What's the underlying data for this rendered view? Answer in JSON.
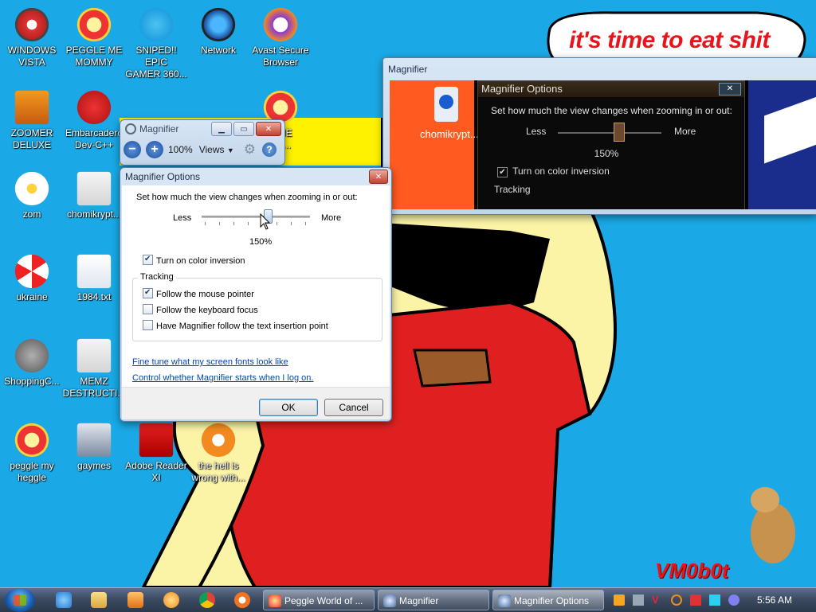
{
  "wallpaper": {
    "banner_text": "it's time to eat shit",
    "signature": "VM0b0t"
  },
  "desktop_icons": [
    {
      "label": "WINDOWS\nVISTA",
      "icon": "windows-vista-icon"
    },
    {
      "label": "PEGGLE ME\nMOMMY",
      "icon": "peggle-icon"
    },
    {
      "label": "SNIPED!! EPIC\nGAMER 360...",
      "icon": "skype-icon"
    },
    {
      "label": "Network",
      "icon": "network-icon"
    },
    {
      "label": "Avast Secure\nBrowser",
      "icon": "avast-browser-icon"
    },
    {
      "label": "ZOOMER\nDELUXE",
      "icon": "zoomer-icon"
    },
    {
      "label": "Embarcadero\nDev-C++",
      "icon": "devcpp-icon"
    },
    {
      "label": "zom",
      "icon": "flower-icon"
    },
    {
      "label": "chomikrypt...",
      "icon": "clock-file-icon"
    },
    {
      "label": "ukraine",
      "icon": "radiation-icon"
    },
    {
      "label": "1984.txt",
      "icon": "text-file-icon"
    },
    {
      "label": "ShoppingC...",
      "icon": "flash-icon"
    },
    {
      "label": "MEMZ\nDESTRUCTI...",
      "icon": "clock-file-icon"
    },
    {
      "label": "peggle my\nheggle",
      "icon": "peggle-icon"
    },
    {
      "label": "gaymes",
      "icon": "folder-icon"
    },
    {
      "label": "Adobe Reader\nXI",
      "icon": "adobe-reader-icon"
    },
    {
      "label": "the hell is\nwrong with...",
      "icon": "uc-browser-icon"
    },
    {
      "label": "E ME\nEA...",
      "icon": "peggle-icon"
    }
  ],
  "magnifier_toolbar": {
    "title": "Magnifier",
    "zoom_level": "100%",
    "views_label": "Views"
  },
  "options_dialog": {
    "title": "Magnifier Options",
    "zoom_prompt": "Set how much the view changes when zooming in or out:",
    "less_label": "Less",
    "more_label": "More",
    "slider_value": "150%",
    "slider_fraction": 0.6,
    "color_inversion_label": "Turn on color inversion",
    "color_inversion_checked": true,
    "tracking_heading": "Tracking",
    "tracking": [
      {
        "label": "Follow the mouse pointer",
        "checked": true
      },
      {
        "label": "Follow the keyboard focus",
        "checked": false
      },
      {
        "label": "Have Magnifier follow the text insertion point",
        "checked": false
      }
    ],
    "link_fonts": "Fine tune what my screen fonts look like",
    "link_startup": "Control whether Magnifier starts when I log on.",
    "ok_label": "OK",
    "cancel_label": "Cancel"
  },
  "magnified_view": {
    "window_title": "Magnifier",
    "dialog_title": "Magnifier Options",
    "zoom_prompt": "Set how much the view changes when zooming in or out:",
    "less_label": "Less",
    "more_label": "More",
    "slider_value": "150%",
    "color_inversion_label": "Turn on color inversion",
    "tracking_heading": "Tracking",
    "icon_label": "chomikrypt..."
  },
  "taskbar": {
    "tasks": [
      {
        "label": "Peggle World of ...",
        "icon": "peggle-icon"
      },
      {
        "label": "Magnifier",
        "icon": "magnifier-icon"
      },
      {
        "label": "Magnifier Options",
        "icon": "magnifier-icon"
      }
    ],
    "clock": "5:56 AM"
  },
  "colors": {
    "desktop": "#1aa9e6",
    "banner_red": "#e8141b",
    "shirt_red": "#e02020",
    "skin": "#fbf3a6"
  }
}
